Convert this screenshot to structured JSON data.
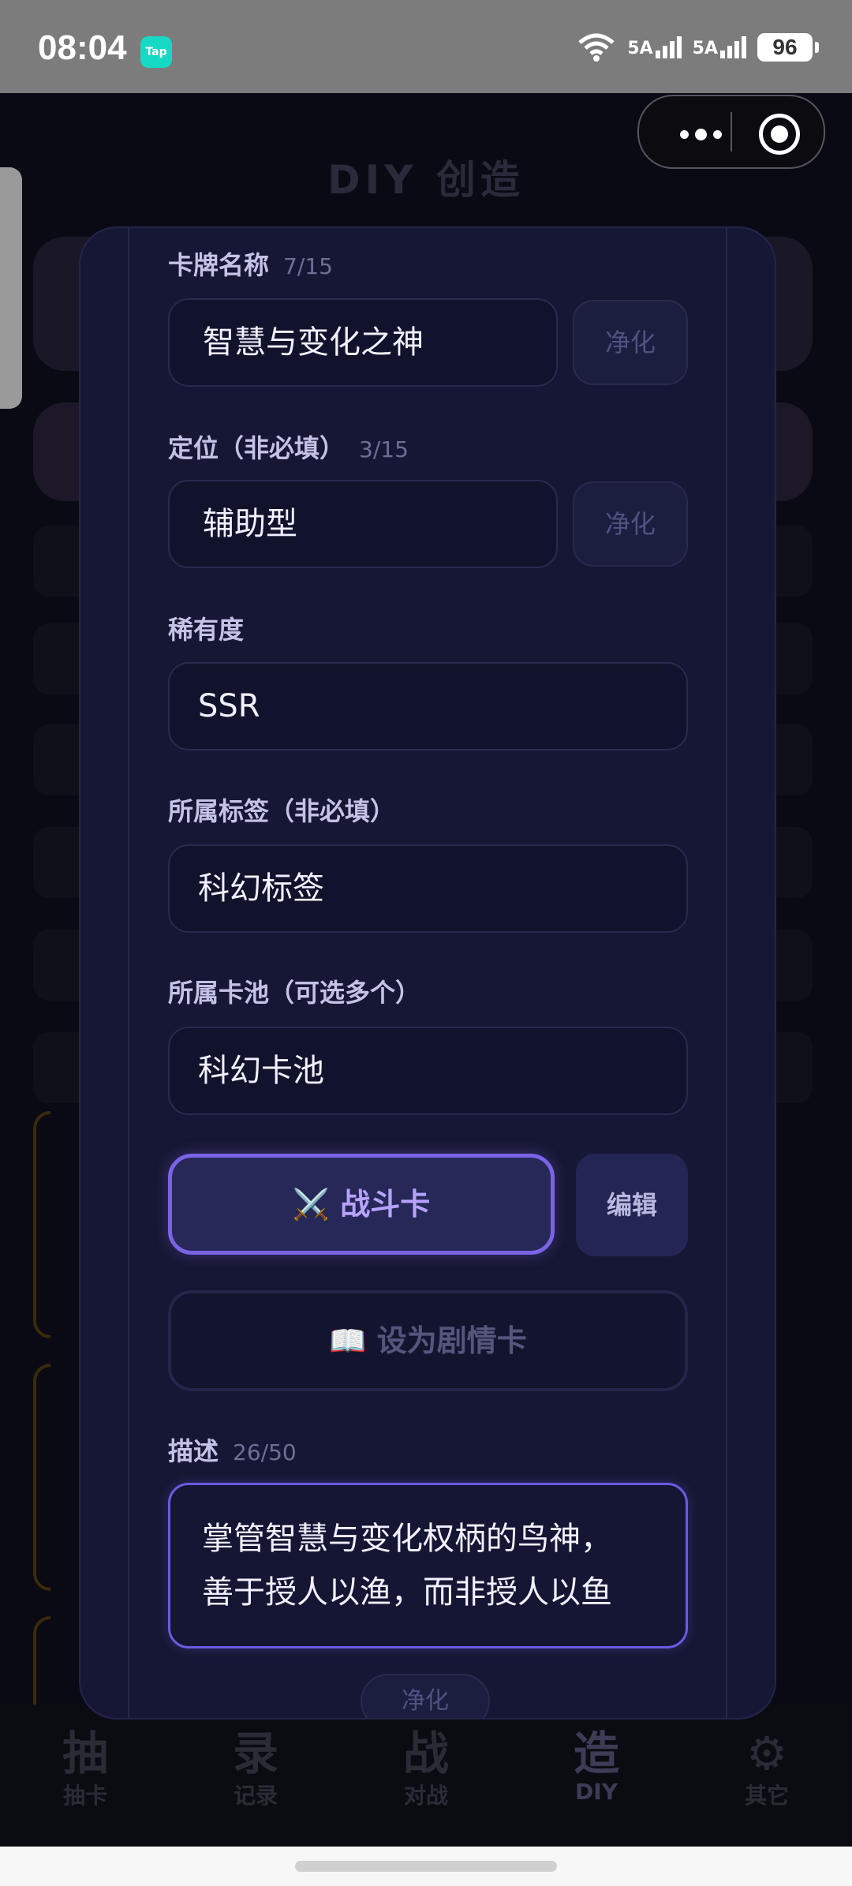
{
  "status_bar": {
    "time": "08:04",
    "app_badge": "Tap",
    "signal1": "5A",
    "signal2": "5A",
    "battery": "96"
  },
  "background": {
    "title": "DIY 创造",
    "tabs": [
      {
        "big": "抽",
        "small": "抽卡"
      },
      {
        "big": "录",
        "small": "记录"
      },
      {
        "big": "战",
        "small": "对战"
      },
      {
        "big": "造",
        "small": "DIY"
      },
      {
        "big": "⚙",
        "small": "其它"
      }
    ]
  },
  "modal": {
    "name_label": "卡牌名称",
    "name_count": "7/15",
    "name_value": "智慧与变化之神",
    "position_label": "定位（非必填）",
    "position_count": "3/15",
    "position_value": "辅助型",
    "purify_label": "净化",
    "rarity_label": "稀有度",
    "rarity_value": "SSR",
    "tag_label": "所属标签（非必填）",
    "tag_value": "科幻标签",
    "pool_label": "所属卡池（可选多个）",
    "pool_value": "科幻卡池",
    "battle_button": "⚔️ 战斗卡",
    "edit_button": "编辑",
    "story_button": "📖 设为剧情卡",
    "desc_label": "描述",
    "desc_count": "26/50",
    "desc_line1": "掌管智慧与变化权柄的鸟神，",
    "desc_line2": "善于授人以渔，而非授人以鱼",
    "bottom_purify": "净化"
  }
}
